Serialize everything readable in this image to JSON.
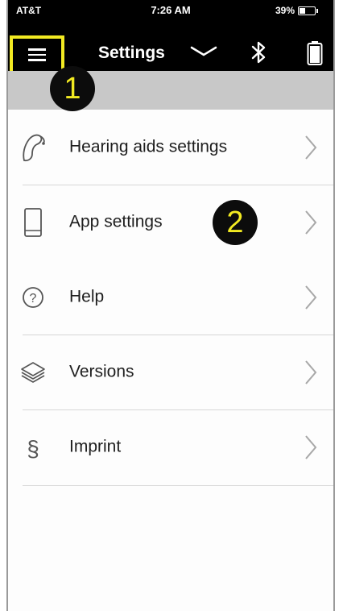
{
  "status_bar": {
    "carrier": "AT&T",
    "time": "7:26 AM",
    "battery": "39%"
  },
  "nav": {
    "title": "Settings"
  },
  "badges": {
    "step1": "1",
    "step2": "2"
  },
  "menu": {
    "items": [
      {
        "label": "Hearing aids settings",
        "icon": "hearing-aid-icon"
      },
      {
        "label": "App settings",
        "icon": "phone-icon"
      },
      {
        "label": "Help",
        "icon": "question-icon"
      },
      {
        "label": "Versions",
        "icon": "layers-icon"
      },
      {
        "label": "Imprint",
        "icon": "section-icon"
      }
    ]
  },
  "colors": {
    "highlight": "#f2ea22",
    "nav_bg": "#000000",
    "grey_bar": "#c8c8c8"
  }
}
